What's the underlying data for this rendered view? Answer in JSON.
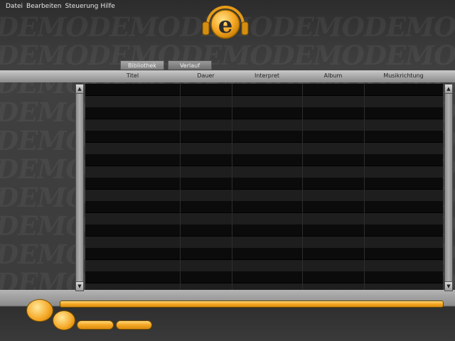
{
  "menu": {
    "items": [
      "Datei",
      "Bearbeiten",
      "Steuerung",
      "Hilfe"
    ]
  },
  "watermark": {
    "text": "DEMODEMODEMODEMODEMODEMODEMODEMODE"
  },
  "logo": {
    "letter": "e",
    "icon": "headphones-e-logo-icon"
  },
  "tabs": [
    {
      "label": "Bibliothek",
      "active": true
    },
    {
      "label": "Verlauf",
      "active": false
    }
  ],
  "table": {
    "columns": [
      "Titel",
      "Dauer",
      "Interpret",
      "Album",
      "Musikrichtung"
    ],
    "rows": []
  },
  "player": {
    "progress": 0
  },
  "colors": {
    "accent": "#f5a623",
    "accent_dark": "#d98c10",
    "background": "#3a3a3a",
    "header": "#c9c9c9"
  }
}
